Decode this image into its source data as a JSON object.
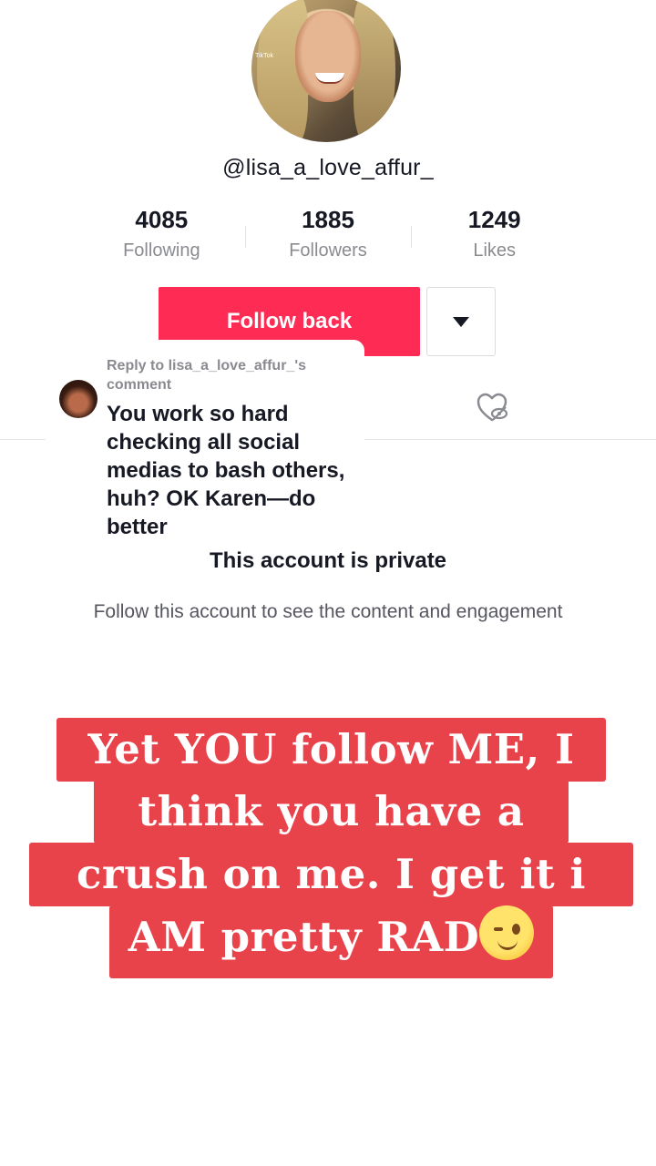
{
  "profile": {
    "avatar_watermark": "TikTok",
    "username": "@lisa_a_love_affur_"
  },
  "stats": [
    {
      "value": "4085",
      "label": "Following"
    },
    {
      "value": "1885",
      "label": "Followers"
    },
    {
      "value": "1249",
      "label": "Likes"
    }
  ],
  "actions": {
    "follow_label": "Follow back",
    "dropdown_icon": "caret-down-icon"
  },
  "reply": {
    "meta": "Reply to lisa_a_love_affur_'s comment",
    "text": "You work so hard checking all social medias to bash others, huh? OK Karen—do better"
  },
  "tabs": {
    "liked_icon": "liked-hidden-icon"
  },
  "private": {
    "title": "This account is private",
    "subtitle": "Follow this account to see the content and engagement"
  },
  "caption": {
    "line1": "Yet YOU follow ME, I",
    "line2": "think you have a",
    "line3": "crush on me. I get it i",
    "line4": "AM pretty RAD",
    "emoji": "winking-face-emoji"
  },
  "colors": {
    "accent": "#fe2c55",
    "caption_bg": "#e8424a"
  }
}
